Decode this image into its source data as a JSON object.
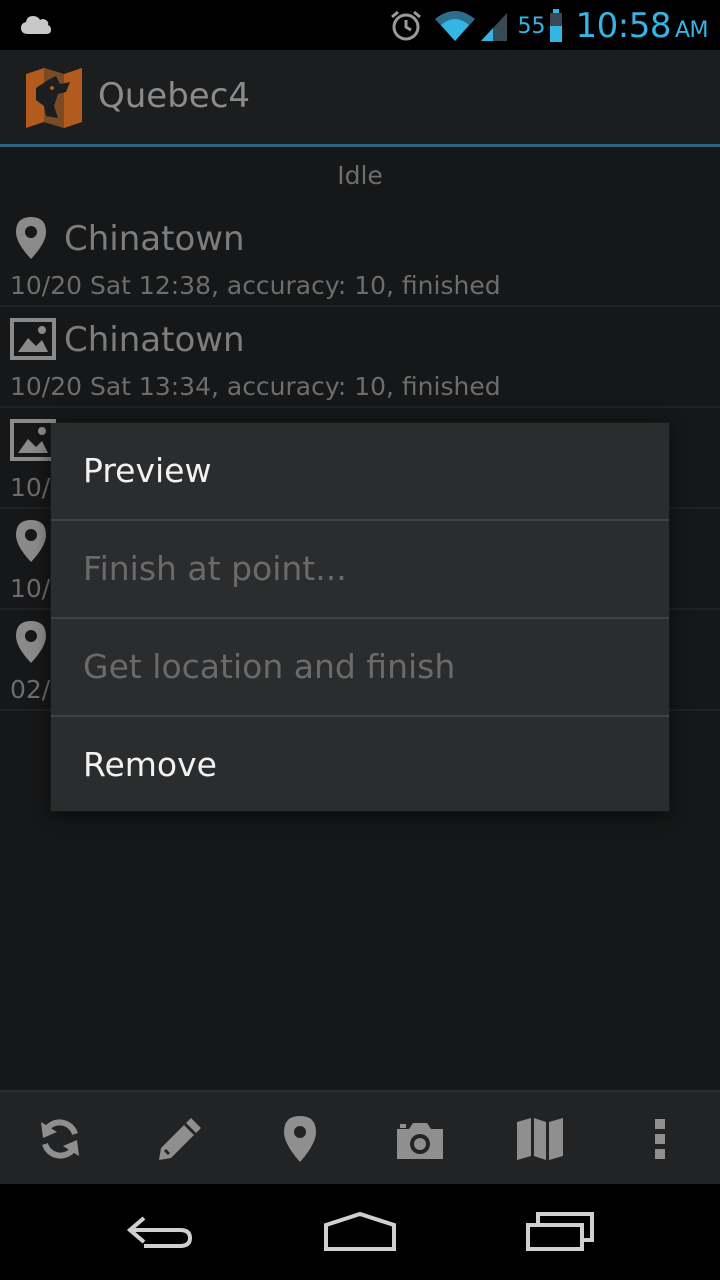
{
  "status_bar": {
    "battery_level": "55",
    "time": "10:58",
    "ampm": "AM",
    "accent_color": "#33b5e5",
    "icons": [
      "cloud-icon",
      "alarm-icon",
      "wifi-icon",
      "signal-icon",
      "battery-icon"
    ]
  },
  "action_bar": {
    "title": "Quebec4"
  },
  "content": {
    "status": "Idle",
    "items": [
      {
        "icon": "location-pin-icon",
        "title": "Chinatown",
        "subtitle": "10/20 Sat 12:38, accuracy: 10, finished"
      },
      {
        "icon": "picture-icon",
        "title": "Chinatown",
        "subtitle": "10/20 Sat 13:34, accuracy: 10, finished"
      },
      {
        "icon": "picture-icon",
        "title": "",
        "subtitle": "10/"
      },
      {
        "icon": "location-pin-icon",
        "title": "",
        "subtitle": "10/"
      },
      {
        "icon": "location-pin-icon",
        "title": "",
        "subtitle": "02/"
      }
    ]
  },
  "context_menu": {
    "items": [
      {
        "label": "Preview",
        "enabled": true
      },
      {
        "label": "Finish at point...",
        "enabled": false
      },
      {
        "label": "Get location and finish",
        "enabled": false
      },
      {
        "label": "Remove",
        "enabled": true
      }
    ]
  },
  "toolbar": {
    "buttons": [
      "refresh-icon",
      "edit-pencil-icon",
      "location-pin-icon",
      "camera-icon",
      "map-icon",
      "overflow-menu-icon"
    ]
  },
  "nav_bar": {
    "buttons": [
      "back-icon",
      "home-icon",
      "recents-icon"
    ]
  }
}
